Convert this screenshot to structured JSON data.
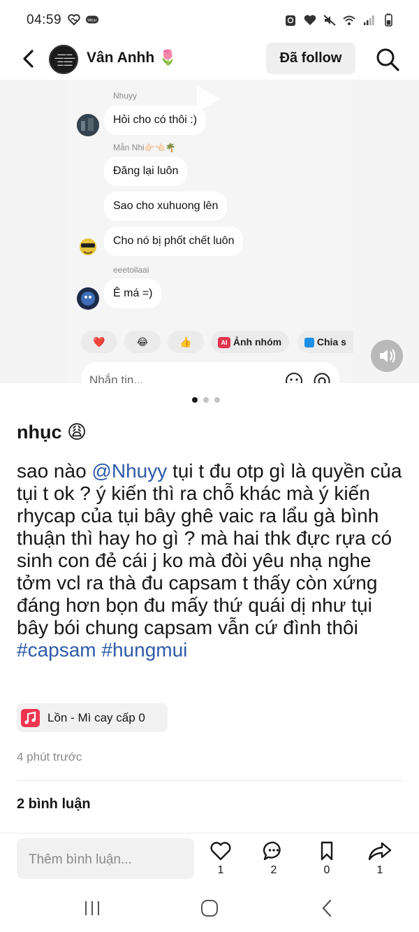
{
  "status_bar": {
    "time": "04:59"
  },
  "header": {
    "username": "Vân Anhh",
    "user_emoji": "🌷",
    "follow_label": "Đã follow"
  },
  "screenshot": {
    "messages": [
      {
        "sender": "Nhuyy",
        "text": "Hỏi cho có thôi :)"
      },
      {
        "sender": "Mẫn Nhi👉🏻👈🏻🌴",
        "text": "Đăng lại luôn"
      },
      {
        "sender": "",
        "text": "Sao cho xuhuong lên"
      },
      {
        "sender": "",
        "text": "Cho nó bị phốt chết luôn"
      },
      {
        "sender": "eeetoilaai",
        "text": "Ê má =)"
      }
    ],
    "reactions": [
      "❤️",
      "😂",
      "👍"
    ],
    "quick_actions": [
      "Ảnh nhóm",
      "Chia s"
    ],
    "ai_badge": "AI",
    "input_placeholder": "Nhắn tin..."
  },
  "carousel": {
    "count": 3,
    "active": 1
  },
  "post": {
    "title": "nhục",
    "title_emoji": "😩",
    "body_prefix": "sao nào ",
    "mention": "@Nhuyy",
    "body_text": " tụi t đu otp gì là quyền của tụi t ok ? ý kiến thì ra chỗ khác mà ý kiến rhycap của tụi bây ghê vaic ra lẩu gà bình thuận thì hay ho gì ? mà hai thk đực rựa có sinh con đẻ cái j ko mà đòi yêu nhạ nghe tởm vcl ra thà đu capsam t thấy còn xứng đáng hơn bọn đu mấy thứ quái dị như tụi bây bói chung capsam vẫn cứ đình thôi ",
    "hashtag_1": "#capsam",
    "hashtag_2": "#hungmui",
    "music": "Lồn - Mì cay cấp 0",
    "timestamp": "4 phút trước",
    "comments_label": "2 bình luận"
  },
  "bottom_bar": {
    "comment_placeholder": "Thêm bình luận...",
    "likes": "1",
    "comments": "2",
    "saves": "0",
    "shares": "1"
  },
  "colors": {
    "link": "#2e5aa8",
    "music_icon": "#f0344f",
    "image_bg": "#f4f4f4"
  }
}
